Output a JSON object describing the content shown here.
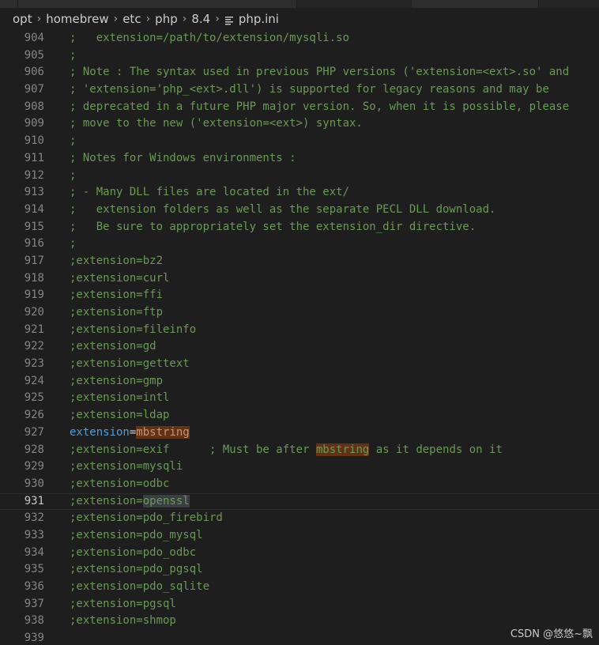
{
  "breadcrumb": {
    "items": [
      "opt",
      "homebrew",
      "etc",
      "php",
      "8.4"
    ],
    "file_icon": "lines-file-icon",
    "file": "php.ini"
  },
  "editor": {
    "current_line": "931",
    "lines": [
      {
        "n": "904",
        "text": ";   extension=/path/to/extension/mysqli.so"
      },
      {
        "n": "905",
        "text": ";"
      },
      {
        "n": "906",
        "text": "; Note : The syntax used in previous PHP versions ('extension=<ext>.so' and"
      },
      {
        "n": "907",
        "text": "; 'extension='php_<ext>.dll') is supported for legacy reasons and may be"
      },
      {
        "n": "908",
        "text": "; deprecated in a future PHP major version. So, when it is possible, please"
      },
      {
        "n": "909",
        "text": "; move to the new ('extension=<ext>) syntax."
      },
      {
        "n": "910",
        "text": ";"
      },
      {
        "n": "911",
        "text": "; Notes for Windows environments :"
      },
      {
        "n": "912",
        "text": ";"
      },
      {
        "n": "913",
        "text": "; - Many DLL files are located in the ext/"
      },
      {
        "n": "914",
        "text": ";   extension folders as well as the separate PECL DLL download."
      },
      {
        "n": "915",
        "text": ";   Be sure to appropriately set the extension_dir directive."
      },
      {
        "n": "916",
        "text": ";"
      },
      {
        "n": "917",
        "text": ";extension=bz2"
      },
      {
        "n": "918",
        "text": ";extension=curl"
      },
      {
        "n": "919",
        "text": ";extension=ffi"
      },
      {
        "n": "920",
        "text": ";extension=ftp"
      },
      {
        "n": "921",
        "text": ";extension=fileinfo"
      },
      {
        "n": "922",
        "text": ";extension=gd"
      },
      {
        "n": "923",
        "text": ";extension=gettext"
      },
      {
        "n": "924",
        "text": ";extension=gmp"
      },
      {
        "n": "925",
        "text": ";extension=intl"
      },
      {
        "n": "926",
        "text": ";extension=ldap"
      },
      {
        "n": "927",
        "key": "extension",
        "eq": "=",
        "val": "mbstring"
      },
      {
        "n": "928",
        "pre": ";extension=exif      ; Must be after ",
        "hl": "mbstring",
        "post": " as it depends on it"
      },
      {
        "n": "929",
        "text": ";extension=mysqli"
      },
      {
        "n": "930",
        "text": ";extension=odbc"
      },
      {
        "n": "931",
        "pre": ";extension=",
        "cur": "openssl"
      },
      {
        "n": "932",
        "text": ";extension=pdo_firebird"
      },
      {
        "n": "933",
        "text": ";extension=pdo_mysql"
      },
      {
        "n": "934",
        "text": ";extension=pdo_odbc"
      },
      {
        "n": "935",
        "text": ";extension=pdo_pgsql"
      },
      {
        "n": "936",
        "text": ";extension=pdo_sqlite"
      },
      {
        "n": "937",
        "text": ";extension=pgsql"
      },
      {
        "n": "938",
        "text": ";extension=shmop"
      },
      {
        "n": "939",
        "text": ""
      }
    ]
  },
  "watermark": "CSDN @悠悠~飘",
  "colors": {
    "background": "#1e1e1e",
    "comment": "#6a9955",
    "keyword": "#569cd6",
    "string": "#ce9178",
    "line_number": "#858585",
    "selection_highlight": "#613214",
    "word_highlight": "#3a3d41"
  }
}
